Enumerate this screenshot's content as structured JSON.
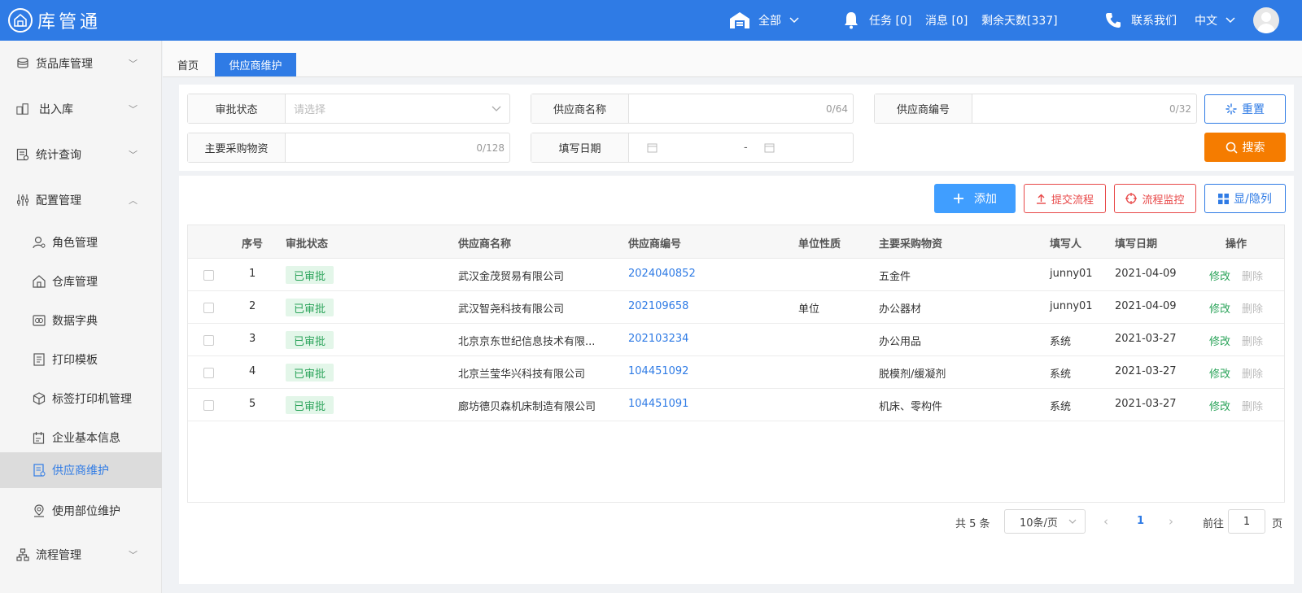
{
  "app": {
    "title": "库管通"
  },
  "topbar": {
    "scope_label": "全部",
    "tasks_label": "任务 [0]",
    "messages_label": "消息 [0]",
    "days_left_label": "剩余天数[337]",
    "contact_label": "联系我们",
    "language_label": "中文"
  },
  "sidebar": {
    "items": [
      {
        "label": "货品库管理"
      },
      {
        "label": "出入库"
      },
      {
        "label": "统计查询"
      },
      {
        "label": "配置管理"
      },
      {
        "label": "角色管理"
      },
      {
        "label": "仓库管理"
      },
      {
        "label": "数据字典"
      },
      {
        "label": "打印模板"
      },
      {
        "label": "标签打印机管理"
      },
      {
        "label": "企业基本信息"
      },
      {
        "label": "供应商维护"
      },
      {
        "label": "使用部位维护"
      },
      {
        "label": "流程管理"
      }
    ]
  },
  "tabs": {
    "home": "首页",
    "active": "供应商维护"
  },
  "search": {
    "status_label": "审批状态",
    "status_placeholder": "请选择",
    "name_label": "供应商名称",
    "name_count": "0/64",
    "code_label": "供应商编号",
    "code_count": "0/32",
    "material_label": "主要采购物资",
    "material_count": "0/128",
    "date_label": "填写日期",
    "date_sep": "-",
    "reset_label": "重置",
    "search_label": "搜索"
  },
  "toolbar": {
    "add_label": "添加",
    "submit_label": "提交流程",
    "monitor_label": "流程监控",
    "columns_label": "显/隐列"
  },
  "table": {
    "headers": [
      "序号",
      "审批状态",
      "供应商名称",
      "供应商编号",
      "单位性质",
      "主要采购物资",
      "填写人",
      "填写日期",
      "操作"
    ],
    "edit_label": "修改",
    "delete_label": "删除",
    "rows": [
      {
        "no": "1",
        "status": "已审批",
        "name": "武汉金茂贸易有限公司",
        "code": "2024040852",
        "unit": "",
        "material": "五金件",
        "writer": "junny01",
        "date": "2021-04-09"
      },
      {
        "no": "2",
        "status": "已审批",
        "name": "武汉智尧科技有限公司",
        "code": "202109658",
        "unit": "单位",
        "material": "办公器材",
        "writer": "junny01",
        "date": "2021-04-09"
      },
      {
        "no": "3",
        "status": "已审批",
        "name": "北京京东世纪信息技术有限...",
        "code": "202103234",
        "unit": "",
        "material": "办公用品",
        "writer": "系统",
        "date": "2021-03-27"
      },
      {
        "no": "4",
        "status": "已审批",
        "name": "北京兰莹华兴科技有限公司",
        "code": "104451092",
        "unit": "",
        "material": "脱模剂/缓凝剂",
        "writer": "系统",
        "date": "2021-03-27"
      },
      {
        "no": "5",
        "status": "已审批",
        "name": "廊坊德贝森机床制造有限公司",
        "code": "104451091",
        "unit": "",
        "material": "机床、零构件",
        "writer": "系统",
        "date": "2021-03-27"
      }
    ]
  },
  "pagination": {
    "total_label": "共 5 条",
    "page_size_label": "10条/页",
    "current_page": "1",
    "goto_label": "前往",
    "goto_value": "1",
    "page_unit": "页"
  },
  "colors": {
    "primary": "#2f7be5",
    "orange": "#f57c00",
    "red": "#e84848",
    "green": "#2ca45b"
  }
}
